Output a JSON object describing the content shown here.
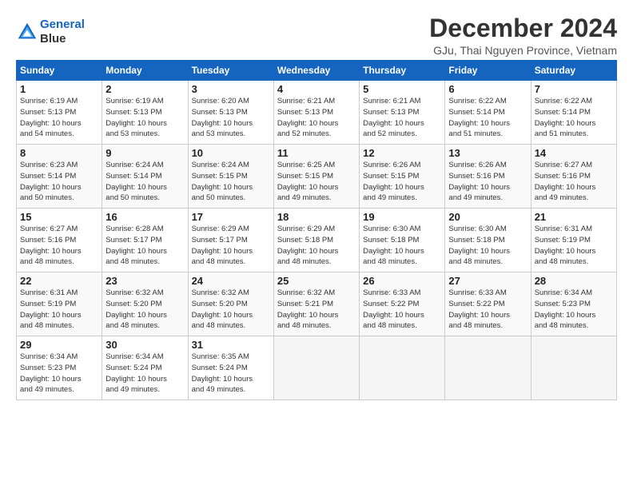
{
  "logo": {
    "line1": "General",
    "line2": "Blue"
  },
  "title": "December 2024",
  "location": "GJu, Thai Nguyen Province, Vietnam",
  "days_of_week": [
    "Sunday",
    "Monday",
    "Tuesday",
    "Wednesday",
    "Thursday",
    "Friday",
    "Saturday"
  ],
  "weeks": [
    [
      {
        "day": "1",
        "info": "Sunrise: 6:19 AM\nSunset: 5:13 PM\nDaylight: 10 hours\nand 54 minutes."
      },
      {
        "day": "2",
        "info": "Sunrise: 6:19 AM\nSunset: 5:13 PM\nDaylight: 10 hours\nand 53 minutes."
      },
      {
        "day": "3",
        "info": "Sunrise: 6:20 AM\nSunset: 5:13 PM\nDaylight: 10 hours\nand 53 minutes."
      },
      {
        "day": "4",
        "info": "Sunrise: 6:21 AM\nSunset: 5:13 PM\nDaylight: 10 hours\nand 52 minutes."
      },
      {
        "day": "5",
        "info": "Sunrise: 6:21 AM\nSunset: 5:13 PM\nDaylight: 10 hours\nand 52 minutes."
      },
      {
        "day": "6",
        "info": "Sunrise: 6:22 AM\nSunset: 5:14 PM\nDaylight: 10 hours\nand 51 minutes."
      },
      {
        "day": "7",
        "info": "Sunrise: 6:22 AM\nSunset: 5:14 PM\nDaylight: 10 hours\nand 51 minutes."
      }
    ],
    [
      {
        "day": "8",
        "info": "Sunrise: 6:23 AM\nSunset: 5:14 PM\nDaylight: 10 hours\nand 50 minutes."
      },
      {
        "day": "9",
        "info": "Sunrise: 6:24 AM\nSunset: 5:14 PM\nDaylight: 10 hours\nand 50 minutes."
      },
      {
        "day": "10",
        "info": "Sunrise: 6:24 AM\nSunset: 5:15 PM\nDaylight: 10 hours\nand 50 minutes."
      },
      {
        "day": "11",
        "info": "Sunrise: 6:25 AM\nSunset: 5:15 PM\nDaylight: 10 hours\nand 49 minutes."
      },
      {
        "day": "12",
        "info": "Sunrise: 6:26 AM\nSunset: 5:15 PM\nDaylight: 10 hours\nand 49 minutes."
      },
      {
        "day": "13",
        "info": "Sunrise: 6:26 AM\nSunset: 5:16 PM\nDaylight: 10 hours\nand 49 minutes."
      },
      {
        "day": "14",
        "info": "Sunrise: 6:27 AM\nSunset: 5:16 PM\nDaylight: 10 hours\nand 49 minutes."
      }
    ],
    [
      {
        "day": "15",
        "info": "Sunrise: 6:27 AM\nSunset: 5:16 PM\nDaylight: 10 hours\nand 48 minutes."
      },
      {
        "day": "16",
        "info": "Sunrise: 6:28 AM\nSunset: 5:17 PM\nDaylight: 10 hours\nand 48 minutes."
      },
      {
        "day": "17",
        "info": "Sunrise: 6:29 AM\nSunset: 5:17 PM\nDaylight: 10 hours\nand 48 minutes."
      },
      {
        "day": "18",
        "info": "Sunrise: 6:29 AM\nSunset: 5:18 PM\nDaylight: 10 hours\nand 48 minutes."
      },
      {
        "day": "19",
        "info": "Sunrise: 6:30 AM\nSunset: 5:18 PM\nDaylight: 10 hours\nand 48 minutes."
      },
      {
        "day": "20",
        "info": "Sunrise: 6:30 AM\nSunset: 5:18 PM\nDaylight: 10 hours\nand 48 minutes."
      },
      {
        "day": "21",
        "info": "Sunrise: 6:31 AM\nSunset: 5:19 PM\nDaylight: 10 hours\nand 48 minutes."
      }
    ],
    [
      {
        "day": "22",
        "info": "Sunrise: 6:31 AM\nSunset: 5:19 PM\nDaylight: 10 hours\nand 48 minutes."
      },
      {
        "day": "23",
        "info": "Sunrise: 6:32 AM\nSunset: 5:20 PM\nDaylight: 10 hours\nand 48 minutes."
      },
      {
        "day": "24",
        "info": "Sunrise: 6:32 AM\nSunset: 5:20 PM\nDaylight: 10 hours\nand 48 minutes."
      },
      {
        "day": "25",
        "info": "Sunrise: 6:32 AM\nSunset: 5:21 PM\nDaylight: 10 hours\nand 48 minutes."
      },
      {
        "day": "26",
        "info": "Sunrise: 6:33 AM\nSunset: 5:22 PM\nDaylight: 10 hours\nand 48 minutes."
      },
      {
        "day": "27",
        "info": "Sunrise: 6:33 AM\nSunset: 5:22 PM\nDaylight: 10 hours\nand 48 minutes."
      },
      {
        "day": "28",
        "info": "Sunrise: 6:34 AM\nSunset: 5:23 PM\nDaylight: 10 hours\nand 48 minutes."
      }
    ],
    [
      {
        "day": "29",
        "info": "Sunrise: 6:34 AM\nSunset: 5:23 PM\nDaylight: 10 hours\nand 49 minutes."
      },
      {
        "day": "30",
        "info": "Sunrise: 6:34 AM\nSunset: 5:24 PM\nDaylight: 10 hours\nand 49 minutes."
      },
      {
        "day": "31",
        "info": "Sunrise: 6:35 AM\nSunset: 5:24 PM\nDaylight: 10 hours\nand 49 minutes."
      },
      {
        "day": "",
        "info": ""
      },
      {
        "day": "",
        "info": ""
      },
      {
        "day": "",
        "info": ""
      },
      {
        "day": "",
        "info": ""
      }
    ]
  ]
}
